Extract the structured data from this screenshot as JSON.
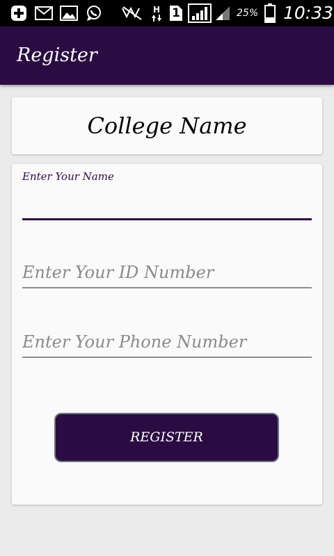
{
  "status_bar": {
    "icons": [
      "add-notification-icon",
      "mail-icon",
      "image-icon",
      "whatsapp-icon",
      "mute-icon",
      "h-data-icon",
      "sim-icon",
      "signal-bars-icon",
      "signal-bars-2-icon",
      "battery-icon"
    ],
    "network_type": "H",
    "sim_number": "1",
    "battery_percent": "25%",
    "battery_level": 0.25,
    "time": "10:33"
  },
  "app_bar": {
    "title": "Register",
    "background_color": "#2a0c43"
  },
  "college_card": {
    "name": "College Name"
  },
  "form": {
    "name_field": {
      "label": "Enter Your Name",
      "value": ""
    },
    "id_field": {
      "placeholder": "Enter Your ID Number",
      "value": ""
    },
    "phone_field": {
      "placeholder": "Enter Your Phone Number",
      "value": ""
    },
    "register_button": {
      "label": "REGISTER"
    }
  }
}
